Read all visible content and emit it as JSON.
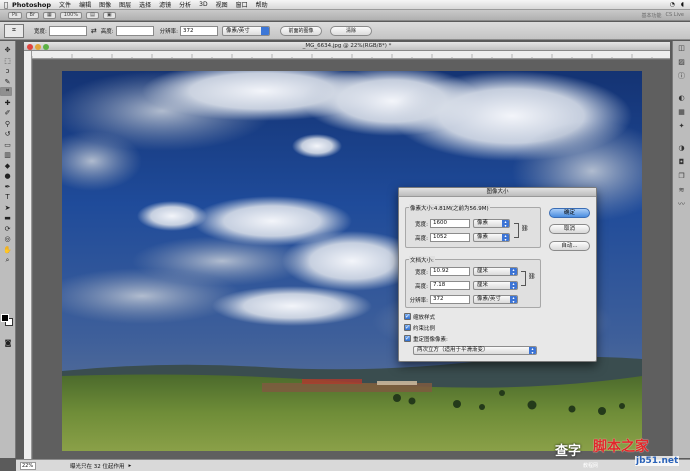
{
  "menubar": {
    "app_name": "Photoshop",
    "items": [
      "文件",
      "编辑",
      "图像",
      "图层",
      "选择",
      "滤镜",
      "分析",
      "3D",
      "视图",
      "窗口",
      "帮助"
    ]
  },
  "appbar": {
    "zoom": "100%",
    "workspace": "基本功能",
    "cs_live": "CS Live"
  },
  "options": {
    "width_label": "宽度:",
    "width_value": "",
    "height_label": "高度:",
    "height_value": "",
    "resolution_label": "分辨率:",
    "resolution_value": "372",
    "resolution_unit": "像素/英寸",
    "front_image_button": "前面的图像",
    "clear_button": "清除"
  },
  "document": {
    "title": "_MG_6634.jpg @ 22%(RGB/8*) *"
  },
  "status": {
    "zoom": "22%",
    "info": "曝光只在 32 位起作用"
  },
  "dialog": {
    "title": "图像大小",
    "pixel_dimensions_label": "像素大小:4.81M(之前为56.9M)",
    "px_width_label": "宽度:",
    "px_width_value": "1600",
    "px_width_unit": "像素",
    "px_height_label": "高度:",
    "px_height_value": "1052",
    "px_height_unit": "像素",
    "doc_size_label": "文档大小:",
    "doc_width_label": "宽度:",
    "doc_width_value": "10.92",
    "doc_width_unit": "厘米",
    "doc_height_label": "高度:",
    "doc_height_value": "7.18",
    "doc_height_unit": "厘米",
    "resolution_label": "分辨率:",
    "resolution_value": "372",
    "resolution_unit": "像素/英寸",
    "scale_styles_label": "缩放样式",
    "scale_styles_checked": true,
    "constrain_label": "约束比例",
    "constrain_checked": true,
    "resample_label": "重定图像像素:",
    "resample_checked": true,
    "resample_method": "两次立方（适用于平滑渐变）",
    "ok_button": "确定",
    "cancel_button": "取消",
    "auto_button": "自动..."
  },
  "watermark": {
    "left_text": "查字",
    "right_text": "脚本之家",
    "url_text": "jb51.net",
    "small_text": "教程网"
  },
  "colors": {
    "accent": "#3c74d5",
    "sky": "#1b3f86"
  }
}
